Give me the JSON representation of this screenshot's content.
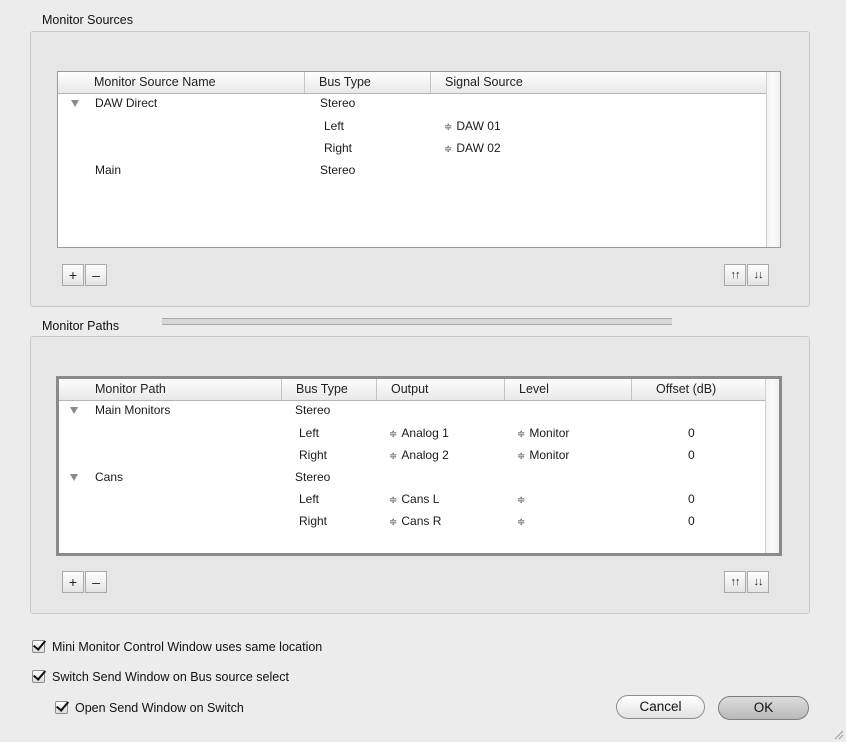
{
  "monitor_sources": {
    "title": "Monitor Sources",
    "columns": [
      "Monitor Source Name",
      "Bus Type",
      "Signal Source"
    ],
    "rows": [
      {
        "name": "DAW Direct",
        "bus": "Stereo",
        "signal": "",
        "expanded": true
      },
      {
        "name": "",
        "bus": "Left",
        "signal": "DAW 01"
      },
      {
        "name": "",
        "bus": "Right",
        "signal": "DAW 02"
      },
      {
        "name": "Main",
        "bus": "Stereo",
        "signal": ""
      }
    ],
    "add_label": "+",
    "remove_label": "–",
    "move_up_label": "↑↑",
    "move_down_label": "↓↓"
  },
  "monitor_paths": {
    "title": "Monitor Paths",
    "columns": [
      "Monitor Path",
      "Bus Type",
      "Output",
      "Level",
      "Offset (dB)"
    ],
    "rows": [
      {
        "name": "Main Monitors",
        "bus": "Stereo",
        "output": "",
        "level": "",
        "offset": "",
        "expanded": true
      },
      {
        "name": "",
        "bus": "Left",
        "output": "Analog 1",
        "level": "Monitor",
        "offset": "0"
      },
      {
        "name": "",
        "bus": "Right",
        "output": "Analog 2",
        "level": "Monitor",
        "offset": "0"
      },
      {
        "name": "Cans",
        "bus": "Stereo",
        "output": "",
        "level": "",
        "offset": "",
        "expanded": true
      },
      {
        "name": "",
        "bus": "Left",
        "output": "Cans L",
        "level": "",
        "offset": "0"
      },
      {
        "name": "",
        "bus": "Right",
        "output": "Cans R",
        "level": "",
        "offset": "0"
      }
    ],
    "add_label": "+",
    "remove_label": "–",
    "move_up_label": "↑↑",
    "move_down_label": "↓↓"
  },
  "options": {
    "mini_monitor": "Mini Monitor Control Window uses same location",
    "switch_send": "Switch Send Window on Bus source select",
    "open_send": "Open Send Window on Switch"
  },
  "buttons": {
    "cancel": "Cancel",
    "ok": "OK"
  },
  "icons": {
    "stepper": "⇕",
    "stepper_glyph": "≑"
  }
}
